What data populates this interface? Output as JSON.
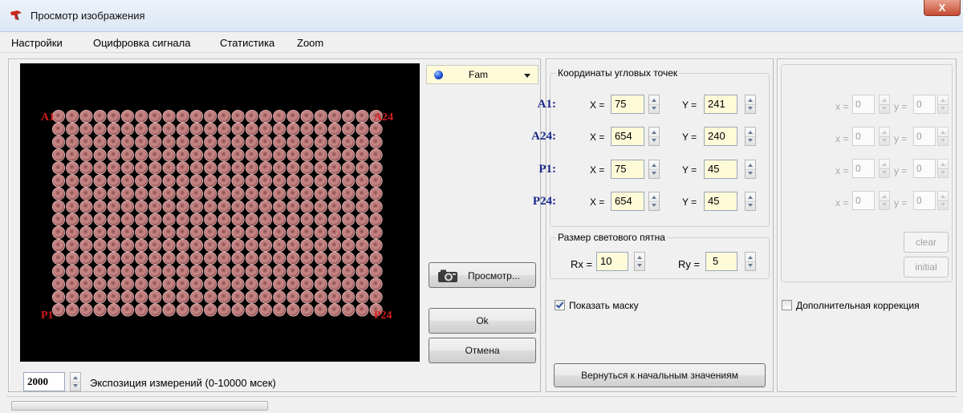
{
  "window": {
    "title": "Просмотр изображения",
    "close_label": "X"
  },
  "menu": {
    "items": [
      "Настройки",
      "Оцифровка сигнала",
      "Статистика",
      "Zoom"
    ]
  },
  "plate": {
    "corner_labels": {
      "A1": "A1",
      "A24": "A24",
      "P1": "P1",
      "P24": "P24"
    },
    "rows": 16,
    "cols": 24
  },
  "channel": {
    "selected": "Fam",
    "dot_color": "#1b4fd6"
  },
  "buttons": {
    "preview": "Просмотр...",
    "ok": "Ok",
    "cancel": "Отмена",
    "reset": "Вернуться к начальным значениям",
    "clear": "clear",
    "initial": "initial"
  },
  "exposure": {
    "value": "2000",
    "label": "Экспозиция измерений (0-10000 мсек)"
  },
  "corners": {
    "title": "Координаты угловых точек",
    "points": [
      {
        "name": "A1:",
        "x": "75",
        "y": "241"
      },
      {
        "name": "A24:",
        "x": "654",
        "y": "240"
      },
      {
        "name": "P1:",
        "x": "75",
        "y": "45"
      },
      {
        "name": "P24:",
        "x": "654",
        "y": "45"
      }
    ],
    "x_label": "X =",
    "y_label": "Y ="
  },
  "spot": {
    "title": "Размер светового пятна",
    "rx_label": "Rx =",
    "rx": "10",
    "ry_label": "Ry =",
    "ry": "5"
  },
  "mask": {
    "label": "Показать маску",
    "checked": true
  },
  "extra": {
    "rows": [
      {
        "x_label": "x =",
        "x": "0",
        "y_label": "y =",
        "y": "0"
      },
      {
        "x_label": "x =",
        "x": "0",
        "y_label": "y =",
        "y": "0"
      },
      {
        "x_label": "x =",
        "x": "0",
        "y_label": "y =",
        "y": "0"
      },
      {
        "x_label": "x =",
        "x": "0",
        "y_label": "y =",
        "y": "0"
      }
    ],
    "correction_label": "Дополнительная коррекция",
    "correction_checked": false
  }
}
